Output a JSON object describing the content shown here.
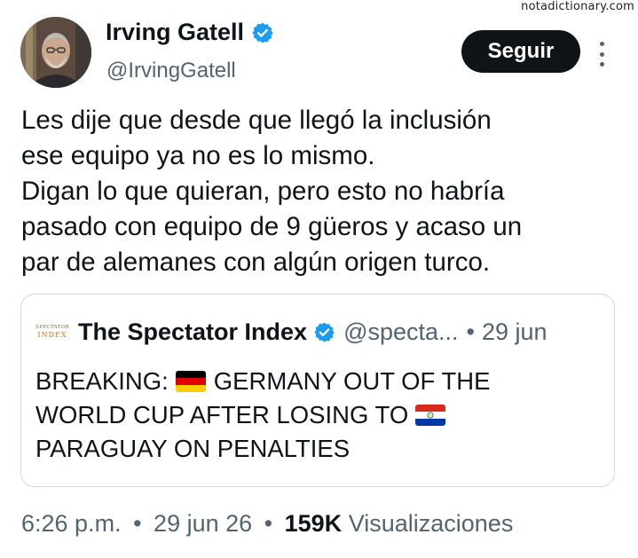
{
  "watermark": "notadictionary.com",
  "author": {
    "display_name": "Irving Gatell",
    "handle": "@IrvingGatell",
    "verified_icon": "verified-badge-icon",
    "verified_color": "#1d9bf0"
  },
  "follow_button": {
    "label": "Seguir"
  },
  "more_menu": {
    "icon": "more-vertical-icon"
  },
  "tweet": {
    "lines": [
      "Les dije que desde que llegó la inclusión",
      "ese equipo ya no es lo mismo.",
      "Digan lo que quieran, pero esto no habría",
      "pasado con equipo de 9 güeros y acaso un",
      "par de alemanes con algún origen turco."
    ]
  },
  "quote": {
    "logo_line1": "SPECTATOR",
    "logo_line2": "INDEX",
    "display_name": "The Spectator Index",
    "handle": "@specta...",
    "dot": "•",
    "date": "29 jun",
    "body_line1_a": "BREAKING:",
    "body_line1_b": "GERMANY OUT OF THE",
    "body_line2": "WORLD CUP AFTER LOSING TO",
    "body_line3": "PARAGUAY ON PENALTIES",
    "flag1": "germany-flag-icon",
    "flag2": "paraguay-flag-icon"
  },
  "meta": {
    "time": "6:26 p.m.",
    "dot": "•",
    "date": "29 jun 26",
    "views_count": "159K",
    "views_label": "Visualizaciones"
  },
  "colors": {
    "text": "#0f1419",
    "secondary": "#536471",
    "border": "#cfd9de",
    "button_bg": "#0f1419",
    "verified": "#1d9bf0"
  }
}
